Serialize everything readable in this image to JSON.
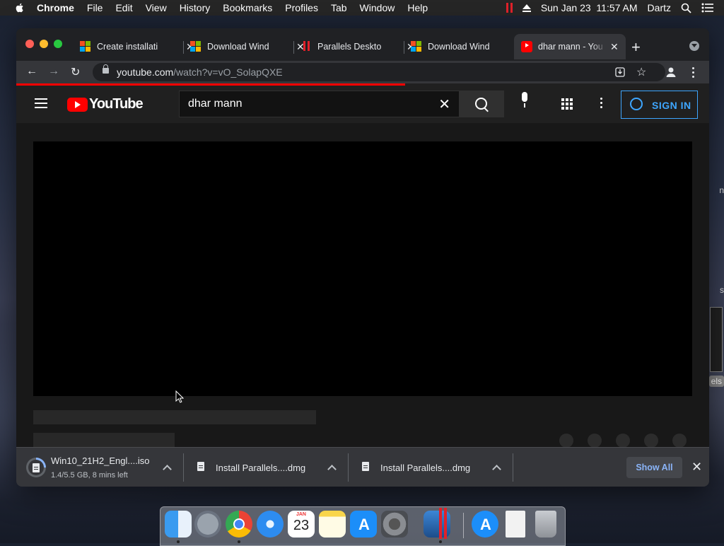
{
  "menubar": {
    "app": "Chrome",
    "menus": [
      "File",
      "Edit",
      "View",
      "History",
      "Bookmarks",
      "Profiles",
      "Tab",
      "Window",
      "Help"
    ],
    "datetime": "Sun Jan 23  11:57 AM",
    "user": "Dartz",
    "icons": [
      "apple-icon",
      "parallels-icon",
      "eject-icon",
      "search-icon",
      "control-center-icon"
    ]
  },
  "tabs": [
    {
      "title": "Create installati",
      "favicon": "microsoft-icon"
    },
    {
      "title": "Download Wind",
      "favicon": "microsoft-icon"
    },
    {
      "title": "Parallels Deskto",
      "favicon": "parallels-icon"
    },
    {
      "title": "Download Wind",
      "favicon": "microsoft-icon"
    },
    {
      "title": "dhar mann - You",
      "favicon": "youtube-icon",
      "active": true
    }
  ],
  "toolbar": {
    "url_host": "youtube.com",
    "url_path": "/watch?v=vO_SolapQXE"
  },
  "youtube": {
    "logo_text": "YouTube",
    "search_query": "dhar mann",
    "sign_in_label": "SIGN IN"
  },
  "downloads": {
    "items": [
      {
        "name": "Win10_21H2_Engl....iso",
        "status": "1.4/5.5 GB, 8 mins left",
        "progress": 0.25
      },
      {
        "name": "Install Parallels....dmg"
      },
      {
        "name": "Install Parallels....dmg"
      }
    ],
    "show_all_label": "Show All"
  },
  "desktop_partial_text": [
    "n",
    "s",
    "els"
  ],
  "dock_apps": [
    "finder",
    "launchpad",
    "chrome",
    "safari",
    "calendar",
    "notes",
    "app-store",
    "system-preferences",
    "parallels-desktop",
    "app-store-folder",
    "document",
    "trash"
  ],
  "calendar": {
    "month": "JAN",
    "day": "23"
  },
  "colors": {
    "accent_blue": "#3ea6ff",
    "youtube_red": "#ff0000",
    "chrome_dark": "#202124",
    "parallels_red": "#e0212a"
  }
}
